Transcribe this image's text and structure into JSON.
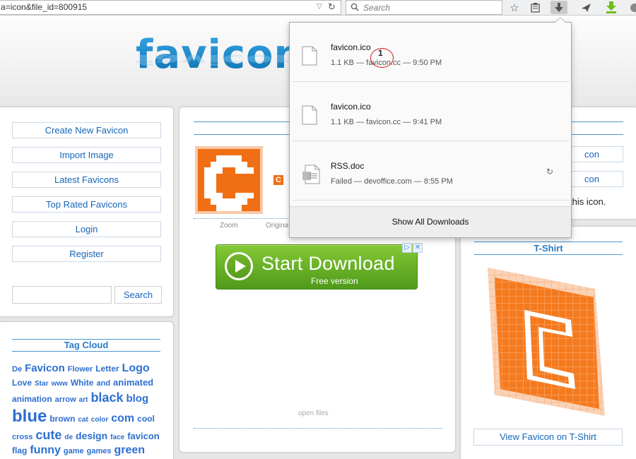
{
  "browser": {
    "url": "a=icon&file_id=800915",
    "search_placeholder": "Search"
  },
  "site": {
    "logo_text": "favicon"
  },
  "left_menu": {
    "items": [
      "Create New Favicon",
      "Import Image",
      "Latest Favicons",
      "Top Rated Favicons",
      "Login",
      "Register"
    ],
    "search_button": "Search"
  },
  "tag_cloud": {
    "title": "Tag Cloud",
    "tags": [
      {
        "text": "De",
        "size": 11
      },
      {
        "text": "Favicon",
        "size": 15
      },
      {
        "text": "Flower",
        "size": 11
      },
      {
        "text": "Letter",
        "size": 12
      },
      {
        "text": "Logo",
        "size": 16
      },
      {
        "text": "Love",
        "size": 12
      },
      {
        "text": "Star",
        "size": 10
      },
      {
        "text": "www",
        "size": 10
      },
      {
        "text": "White",
        "size": 12
      },
      {
        "text": "and",
        "size": 11
      },
      {
        "text": "animated",
        "size": 13
      },
      {
        "text": "animation",
        "size": 12
      },
      {
        "text": "arrow",
        "size": 11
      },
      {
        "text": "art",
        "size": 10
      },
      {
        "text": "black",
        "size": 18
      },
      {
        "text": "blog",
        "size": 15
      },
      {
        "text": "blue",
        "size": 24
      },
      {
        "text": "brown",
        "size": 12
      },
      {
        "text": "cat",
        "size": 10
      },
      {
        "text": "color",
        "size": 10
      },
      {
        "text": "com",
        "size": 16
      },
      {
        "text": "cool",
        "size": 12
      },
      {
        "text": "cross",
        "size": 11
      },
      {
        "text": "cute",
        "size": 18
      },
      {
        "text": "de",
        "size": 10
      },
      {
        "text": "design",
        "size": 14
      },
      {
        "text": "face",
        "size": 10
      },
      {
        "text": "favicon",
        "size": 13
      },
      {
        "text": "flag",
        "size": 12
      },
      {
        "text": "funny",
        "size": 16
      },
      {
        "text": "game",
        "size": 11
      },
      {
        "text": "games",
        "size": 11
      },
      {
        "text": "green",
        "size": 16
      }
    ]
  },
  "center": {
    "zoom_label": "Zoom",
    "original_label": "Origina",
    "small_icon_letter": "C",
    "open_files_label": "open files",
    "ad": {
      "title": "Start Download",
      "subtitle": "Free version",
      "adchoices_label": "▷",
      "close_label": "✕"
    }
  },
  "right_panel": {
    "partial_link_1": "con",
    "partial_link_2": "con",
    "partial_text": "this icon.",
    "tshirt_title": "T-Shirt",
    "tshirt_link": "View Favicon on T-Shirt"
  },
  "downloads": {
    "items": [
      {
        "name": "favicon.ico",
        "meta": "1.1 KB — favicon.cc — 9:50 PM",
        "status": "done"
      },
      {
        "name": "favicon.ico",
        "meta": "1.1 KB — favicon.cc — 9:41 PM",
        "status": "done"
      },
      {
        "name": "RSS.doc",
        "meta": "Failed — devoffice.com — 8:55 PM",
        "status": "failed"
      }
    ],
    "show_all": "Show All Downloads",
    "annotation_number": "1"
  },
  "colors": {
    "link_blue": "#1565b8",
    "header_blue": "#2a7bc4",
    "favicon_orange": "#f06f14",
    "ad_green": "#5fae22"
  }
}
